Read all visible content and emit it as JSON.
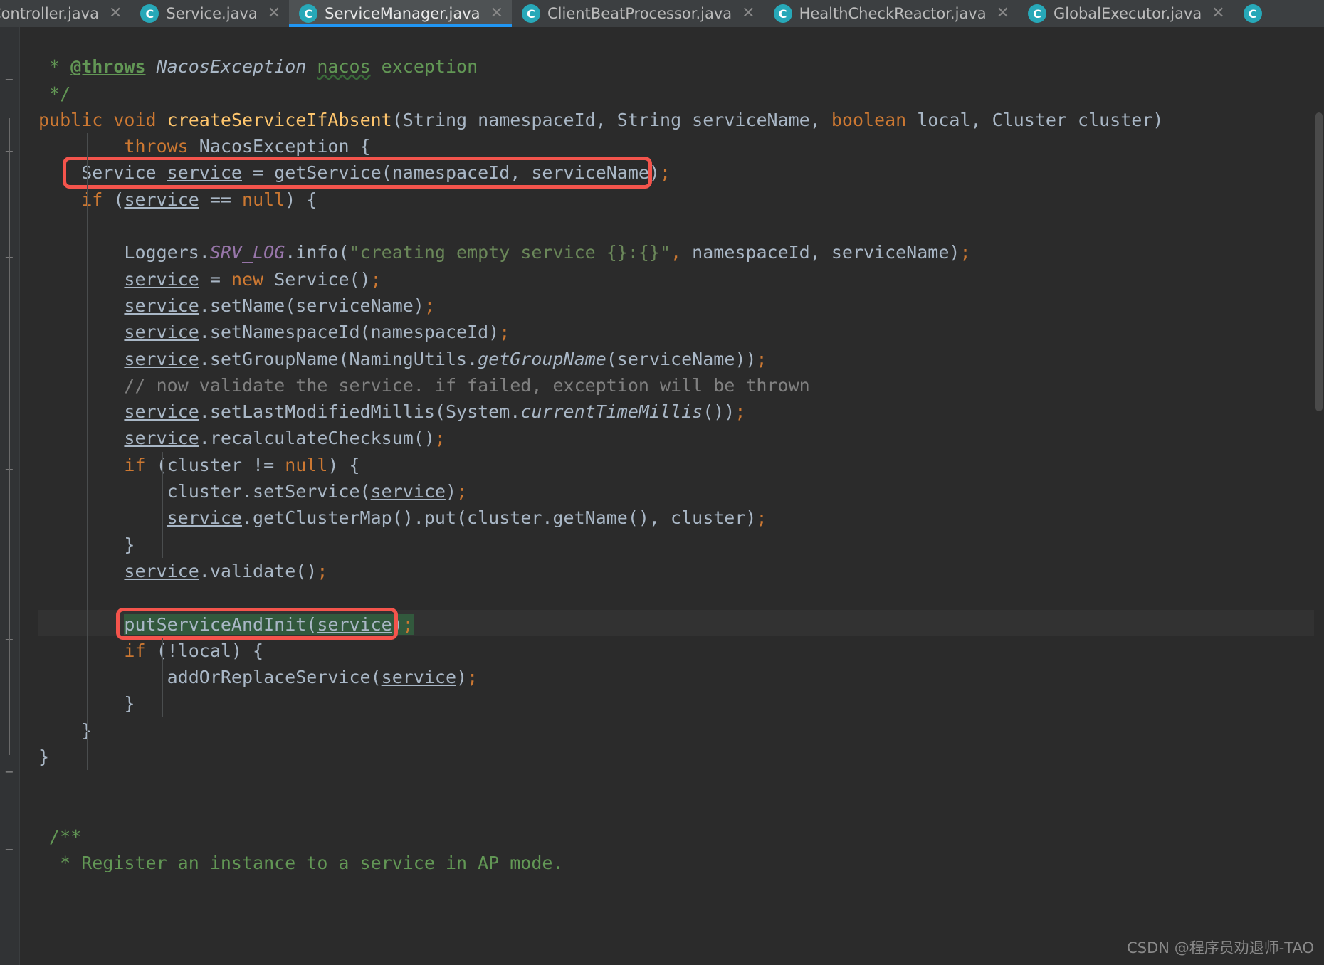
{
  "window": {
    "app": "IntelliJ IDEA",
    "theme_background": "#2b2b2b",
    "accent": "#2196f3"
  },
  "tabbar": {
    "close_glyph": "✕",
    "class_icon_letter": "C",
    "class_icon_color": "#27a8b8",
    "tabs": [
      {
        "label": "eController.java",
        "active": false,
        "clipped": true,
        "has_icon": false
      },
      {
        "label": "Service.java",
        "active": false,
        "clipped": false,
        "has_icon": true
      },
      {
        "label": "ServiceManager.java",
        "active": true,
        "clipped": false,
        "has_icon": true
      },
      {
        "label": "ClientBeatProcessor.java",
        "active": false,
        "clipped": false,
        "has_icon": true
      },
      {
        "label": "HealthCheckReactor.java",
        "active": false,
        "clipped": false,
        "has_icon": true
      },
      {
        "label": "GlobalExecutor.java",
        "active": false,
        "clipped": false,
        "has_icon": true
      }
    ]
  },
  "annotations": {
    "boxes": [
      {
        "name": "highlight-get-service",
        "label": "Service service = getService(namespaceId, serviceName);",
        "color": "#f4544c"
      },
      {
        "name": "highlight-put-service-and-init",
        "label": "putServiceAndInit(service);",
        "color": "#f4544c"
      }
    ]
  },
  "watermark": {
    "text": "CSDN @程序员劝退师-TAO"
  },
  "code": {
    "language": "Java",
    "file": "ServiceManager.java",
    "lines": [
      {
        "indent": 0,
        "tokens": []
      },
      {
        "indent": 0,
        "tokens": [
          {
            "t": " * ",
            "c": "jdoc"
          },
          {
            "t": "@throws",
            "c": "jtag"
          },
          {
            "t": " ",
            "c": "jdoc"
          },
          {
            "t": "NacosException",
            "c": "jtype"
          },
          {
            "t": " ",
            "c": "jdoc"
          },
          {
            "t": "nacos",
            "c": "warnw"
          },
          {
            "t": " exception",
            "c": "jdoc"
          }
        ]
      },
      {
        "indent": 0,
        "tokens": [
          {
            "t": " */",
            "c": "jdoc"
          }
        ]
      },
      {
        "indent": 0,
        "tokens": [
          {
            "t": "public",
            "c": "kw"
          },
          {
            "t": " ",
            "c": "def"
          },
          {
            "t": "void",
            "c": "kw"
          },
          {
            "t": " ",
            "c": "def"
          },
          {
            "t": "createServiceIfAbsent",
            "c": "mname"
          },
          {
            "t": "(String namespaceId, String serviceName, ",
            "c": "def"
          },
          {
            "t": "boolean",
            "c": "kw"
          },
          {
            "t": " local, Cluster cluster)",
            "c": "def"
          }
        ]
      },
      {
        "indent": 0,
        "tokens": [
          {
            "t": "        ",
            "c": "def"
          },
          {
            "t": "throws",
            "c": "kw"
          },
          {
            "t": " NacosException {",
            "c": "def"
          }
        ]
      },
      {
        "indent": 0,
        "tokens": [
          {
            "t": "    Service ",
            "c": "def"
          },
          {
            "t": "service",
            "c": "lvar"
          },
          {
            "t": " = getService(namespaceId, serviceName)",
            "c": "def"
          },
          {
            "t": ";",
            "c": "sem"
          }
        ]
      },
      {
        "indent": 0,
        "tokens": [
          {
            "t": "    ",
            "c": "def"
          },
          {
            "t": "if",
            "c": "kw"
          },
          {
            "t": " (",
            "c": "def"
          },
          {
            "t": "service",
            "c": "lvar"
          },
          {
            "t": " == ",
            "c": "def"
          },
          {
            "t": "null",
            "c": "kw"
          },
          {
            "t": ") {",
            "c": "def"
          }
        ]
      },
      {
        "indent": 0,
        "tokens": []
      },
      {
        "indent": 0,
        "tokens": [
          {
            "t": "        Loggers.",
            "c": "def"
          },
          {
            "t": "SRV_LOG",
            "c": "sfield"
          },
          {
            "t": ".info(",
            "c": "def"
          },
          {
            "t": "\"creating empty service {}:{}\"",
            "c": "str"
          },
          {
            "t": ",",
            "c": "sem"
          },
          {
            "t": " namespaceId, serviceName)",
            "c": "def"
          },
          {
            "t": ";",
            "c": "sem"
          }
        ]
      },
      {
        "indent": 0,
        "tokens": [
          {
            "t": "        ",
            "c": "def"
          },
          {
            "t": "service",
            "c": "lvar"
          },
          {
            "t": " = ",
            "c": "def"
          },
          {
            "t": "new",
            "c": "kw"
          },
          {
            "t": " Service()",
            "c": "def"
          },
          {
            "t": ";",
            "c": "sem"
          }
        ]
      },
      {
        "indent": 0,
        "tokens": [
          {
            "t": "        ",
            "c": "def"
          },
          {
            "t": "service",
            "c": "lvar"
          },
          {
            "t": ".setName(serviceName)",
            "c": "def"
          },
          {
            "t": ";",
            "c": "sem"
          }
        ]
      },
      {
        "indent": 0,
        "tokens": [
          {
            "t": "        ",
            "c": "def"
          },
          {
            "t": "service",
            "c": "lvar"
          },
          {
            "t": ".setNamespaceId(namespaceId)",
            "c": "def"
          },
          {
            "t": ";",
            "c": "sem"
          }
        ]
      },
      {
        "indent": 0,
        "tokens": [
          {
            "t": "        ",
            "c": "def"
          },
          {
            "t": "service",
            "c": "lvar"
          },
          {
            "t": ".setGroupName(NamingUtils.",
            "c": "def"
          },
          {
            "t": "getGroupName",
            "c": "smeth"
          },
          {
            "t": "(serviceName))",
            "c": "def"
          },
          {
            "t": ";",
            "c": "sem"
          }
        ]
      },
      {
        "indent": 0,
        "tokens": [
          {
            "t": "        // now validate the service. if failed, exception will be thrown",
            "c": "cmt"
          }
        ]
      },
      {
        "indent": 0,
        "tokens": [
          {
            "t": "        ",
            "c": "def"
          },
          {
            "t": "service",
            "c": "lvar"
          },
          {
            "t": ".setLastModifiedMillis(System.",
            "c": "def"
          },
          {
            "t": "currentTimeMillis",
            "c": "smeth"
          },
          {
            "t": "())",
            "c": "def"
          },
          {
            "t": ";",
            "c": "sem"
          }
        ]
      },
      {
        "indent": 0,
        "tokens": [
          {
            "t": "        ",
            "c": "def"
          },
          {
            "t": "service",
            "c": "lvar"
          },
          {
            "t": ".recalculateChecksum()",
            "c": "def"
          },
          {
            "t": ";",
            "c": "sem"
          }
        ]
      },
      {
        "indent": 0,
        "tokens": [
          {
            "t": "        ",
            "c": "def"
          },
          {
            "t": "if",
            "c": "kw"
          },
          {
            "t": " (cluster != ",
            "c": "def"
          },
          {
            "t": "null",
            "c": "kw"
          },
          {
            "t": ") {",
            "c": "def"
          }
        ]
      },
      {
        "indent": 0,
        "tokens": [
          {
            "t": "            cluster.setService(",
            "c": "def"
          },
          {
            "t": "service",
            "c": "lvar"
          },
          {
            "t": ")",
            "c": "def"
          },
          {
            "t": ";",
            "c": "sem"
          }
        ]
      },
      {
        "indent": 0,
        "tokens": [
          {
            "t": "            ",
            "c": "def"
          },
          {
            "t": "service",
            "c": "lvar"
          },
          {
            "t": ".getClusterMap().put(cluster.getName(), cluster)",
            "c": "def"
          },
          {
            "t": ";",
            "c": "sem"
          }
        ]
      },
      {
        "indent": 0,
        "tokens": [
          {
            "t": "        }",
            "c": "def"
          }
        ]
      },
      {
        "indent": 0,
        "tokens": [
          {
            "t": "        ",
            "c": "def"
          },
          {
            "t": "service",
            "c": "lvar"
          },
          {
            "t": ".validate()",
            "c": "def"
          },
          {
            "t": ";",
            "c": "sem"
          }
        ]
      },
      {
        "indent": 0,
        "tokens": []
      },
      {
        "indent": 0,
        "tokens": [
          {
            "t": "        ",
            "c": "def"
          },
          {
            "t": "putServiceAndInit(",
            "c": "def green-sel"
          },
          {
            "t": "service",
            "c": "lvar green-sel"
          },
          {
            "t": ")",
            "c": "def green-sel"
          },
          {
            "t": ";",
            "c": "sem green-sel"
          }
        ]
      },
      {
        "indent": 0,
        "tokens": [
          {
            "t": "        ",
            "c": "def"
          },
          {
            "t": "if",
            "c": "kw"
          },
          {
            "t": " (!local) {",
            "c": "def"
          }
        ]
      },
      {
        "indent": 0,
        "tokens": [
          {
            "t": "            addOrReplaceService(",
            "c": "def"
          },
          {
            "t": "service",
            "c": "lvar"
          },
          {
            "t": ")",
            "c": "def"
          },
          {
            "t": ";",
            "c": "sem"
          }
        ]
      },
      {
        "indent": 0,
        "tokens": [
          {
            "t": "        }",
            "c": "def"
          }
        ]
      },
      {
        "indent": 0,
        "tokens": [
          {
            "t": "    }",
            "c": "def"
          }
        ]
      },
      {
        "indent": 0,
        "tokens": [
          {
            "t": "}",
            "c": "def"
          }
        ]
      },
      {
        "indent": 0,
        "tokens": []
      },
      {
        "indent": 0,
        "tokens": []
      },
      {
        "indent": 0,
        "tokens": [
          {
            "t": " /**",
            "c": "jdoc"
          }
        ]
      },
      {
        "indent": 0,
        "tokens": [
          {
            "t": "  * Register an instance to a service in AP mode.",
            "c": "jdoc"
          }
        ]
      }
    ]
  }
}
